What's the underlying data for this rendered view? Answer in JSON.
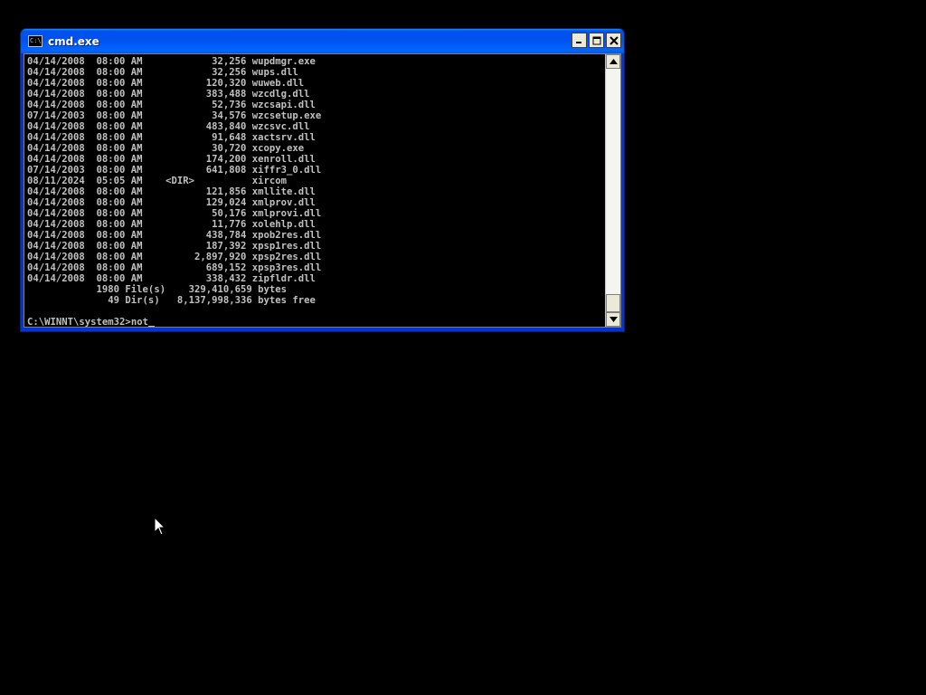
{
  "window": {
    "title": "cmd.exe",
    "icon": "console-icon",
    "icon_text": "C:\\",
    "buttons": {
      "minimize": "_",
      "maximize": "□",
      "close": "✕"
    }
  },
  "console": {
    "lines": [
      "04/14/2008  08:00 AM            32,256 wupdmgr.exe",
      "04/14/2008  08:00 AM            32,256 wups.dll",
      "04/14/2008  08:00 AM           120,320 wuweb.dll",
      "04/14/2008  08:00 AM           383,488 wzcdlg.dll",
      "04/14/2008  08:00 AM            52,736 wzcsapi.dll",
      "07/14/2003  08:00 AM            34,576 wzcsetup.exe",
      "04/14/2008  08:00 AM           483,840 wzcsvc.dll",
      "04/14/2008  08:00 AM            91,648 xactsrv.dll",
      "04/14/2008  08:00 AM            30,720 xcopy.exe",
      "04/14/2008  08:00 AM           174,200 xenroll.dll",
      "07/14/2003  08:00 AM           641,808 xiffr3_0.dll",
      "08/11/2024  05:05 AM    <DIR>          xircom",
      "04/14/2008  08:00 AM           121,856 xmllite.dll",
      "04/14/2008  08:00 AM           129,024 xmlprov.dll",
      "04/14/2008  08:00 AM            50,176 xmlprovi.dll",
      "04/14/2008  08:00 AM            11,776 xolehlp.dll",
      "04/14/2008  08:00 AM           438,784 xpob2res.dll",
      "04/14/2008  08:00 AM           187,392 xpsp1res.dll",
      "04/14/2008  08:00 AM         2,897,920 xpsp2res.dll",
      "04/14/2008  08:00 AM           689,152 xpsp3res.dll",
      "04/14/2008  08:00 AM           338,432 zipfldr.dll",
      "            1980 File(s)    329,410,659 bytes",
      "              49 Dir(s)   8,137,998,336 bytes free",
      ""
    ],
    "prompt": "C:\\WINNT\\system32>",
    "input": "not"
  },
  "scrollbar": {
    "up_arrow": "▲",
    "down_arrow": "▼"
  }
}
